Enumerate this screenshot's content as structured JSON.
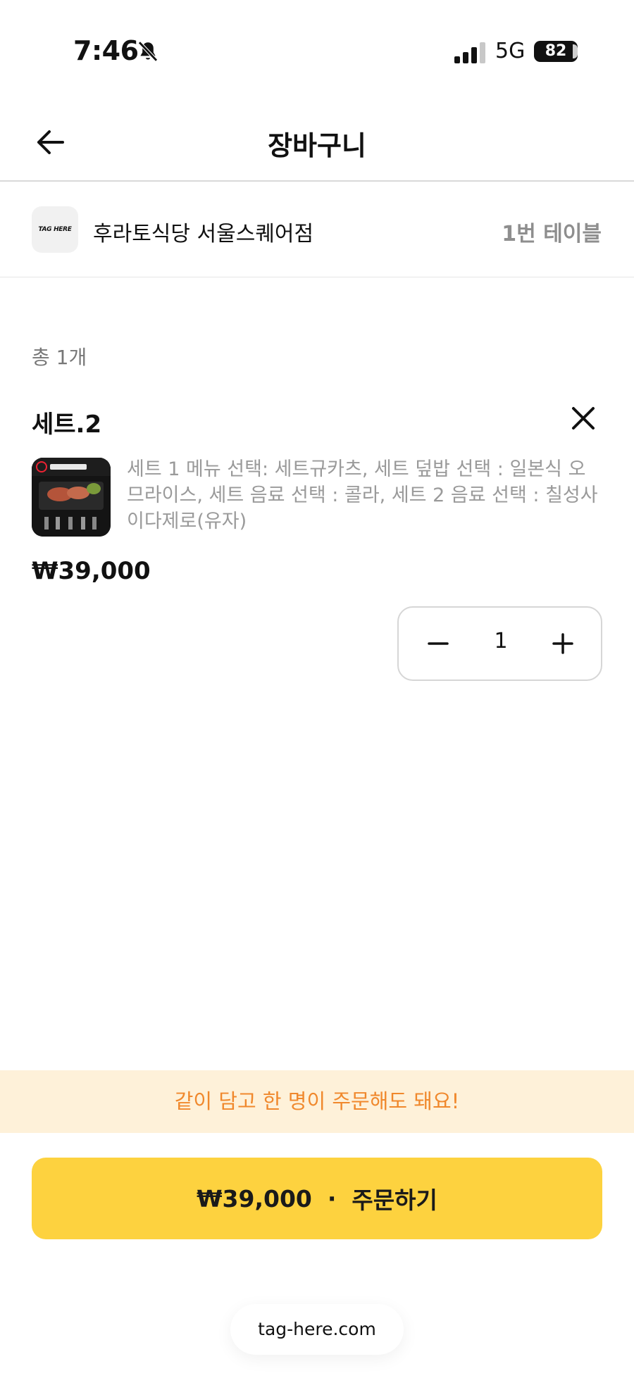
{
  "status_bar": {
    "time": "7:46",
    "network": "5G",
    "battery": "82"
  },
  "header": {
    "title": "장바구니"
  },
  "store": {
    "logo_text": "TAG HERE",
    "name": "후라토식당 서울스퀘어점",
    "table": "1번 테이블"
  },
  "cart": {
    "count_label": "총 1개",
    "items": [
      {
        "name": "세트.2",
        "options": "세트 1 메뉴 선택: 세트규카츠, 세트 덮밥 선택 : 일본식 오므라이스, 세트 음료 선택 : 콜라, 세트 2 음료 선택 : 칠성사이다제로(유자)",
        "price": "₩39,000",
        "quantity": "1"
      }
    ]
  },
  "banner": {
    "text": "같이 담고 한 명이 주문해도 돼요!"
  },
  "order_button": {
    "price": "₩39,000",
    "separator": "·",
    "label": "주문하기"
  },
  "footer": {
    "link": "tag-here.com"
  },
  "colors": {
    "accent": "#fdd23f",
    "banner_bg": "#fef1d9",
    "banner_text": "#f0882c"
  }
}
